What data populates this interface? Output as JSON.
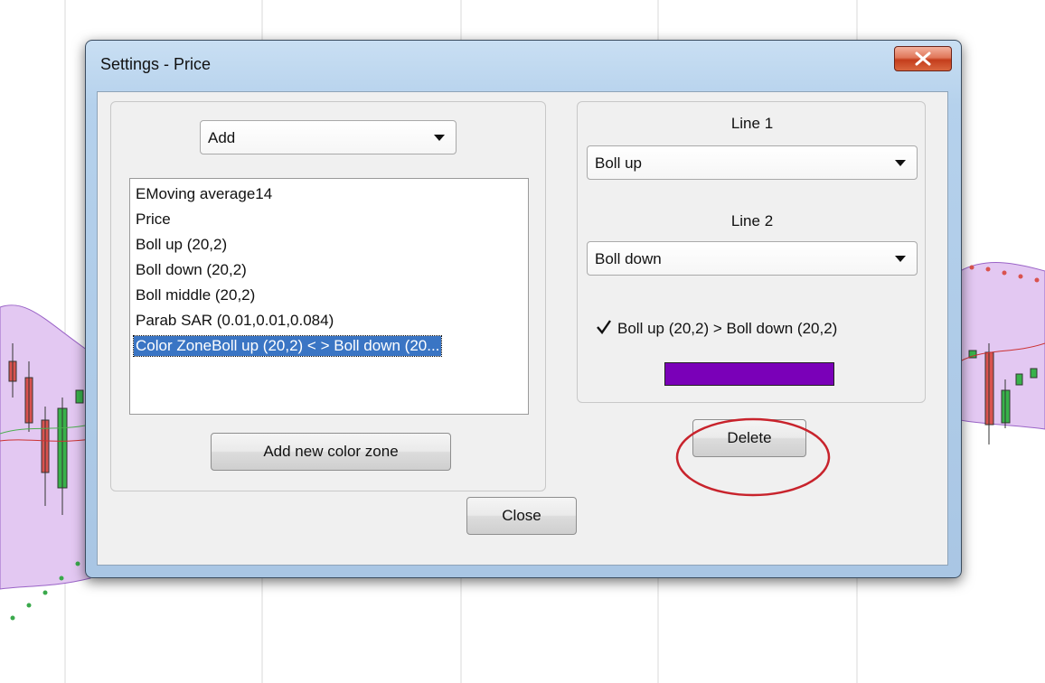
{
  "window": {
    "title": "Settings - Price"
  },
  "left_panel": {
    "add_dropdown": {
      "selected": "Add"
    },
    "indicator_list": [
      {
        "label": "EMoving average14",
        "selected": false
      },
      {
        "label": "Price",
        "selected": false
      },
      {
        "label": "Boll up (20,2)",
        "selected": false
      },
      {
        "label": "Boll down (20,2)",
        "selected": false
      },
      {
        "label": "Boll middle (20,2)",
        "selected": false
      },
      {
        "label": "Parab SAR (0.01,0.01,0.084)",
        "selected": false
      },
      {
        "label": "Color ZoneBoll up (20,2) < > Boll down (20...",
        "selected": true
      }
    ],
    "add_color_zone_label": "Add new color zone"
  },
  "right_panel": {
    "line1_label": "Line 1",
    "line1_dropdown": {
      "selected": "Boll up"
    },
    "line2_label": "Line 2",
    "line2_dropdown": {
      "selected": "Boll down"
    },
    "condition_checkbox": {
      "checked": true,
      "label": "Boll up (20,2) > Boll down (20,2)"
    },
    "zone_color": "#7a00b8",
    "delete_label": "Delete"
  },
  "footer": {
    "close_label": "Close"
  },
  "colors": {
    "accent_selection": "#3a75c4",
    "band_fill": "#e3c8f2",
    "highlight_circle": "#c8232c"
  }
}
